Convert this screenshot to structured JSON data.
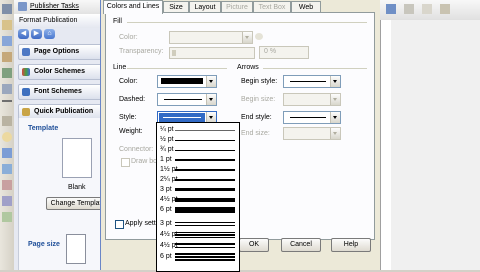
{
  "menu": {
    "partial_title": "Publisher Tasks"
  },
  "task_pane": {
    "title": "Format Publication",
    "sections": [
      {
        "label": "Page Options"
      },
      {
        "label": "Color Schemes"
      },
      {
        "label": "Font Schemes"
      },
      {
        "label": "Quick Publication"
      }
    ],
    "template_label": "Template",
    "template_name": "Blank",
    "change_template_button": "Change Template",
    "page_size_label": "Page size"
  },
  "dialog": {
    "tabs": [
      {
        "label": "Colors and Lines",
        "active": true
      },
      {
        "label": "Size"
      },
      {
        "label": "Layout"
      },
      {
        "label": "Picture",
        "disabled": true
      },
      {
        "label": "Text Box",
        "disabled": true
      },
      {
        "label": "Web"
      }
    ],
    "fill": {
      "group_label": "Fill",
      "color_label": "Color:",
      "transparency_label": "Transparency:",
      "transparency_value": "0 %"
    },
    "line": {
      "group_label": "Line",
      "color_label": "Color:",
      "dashed_label": "Dashed:",
      "style_label": "Style:",
      "weight_label": "Weight:",
      "connector_label": "Connector:",
      "draw_border_label": "Draw bor"
    },
    "arrows": {
      "group_label": "Arrows",
      "begin_style_label": "Begin style:",
      "begin_size_label": "Begin size:",
      "end_style_label": "End style:",
      "end_size_label": "End size:"
    },
    "apply_settings_label": "Apply setti",
    "buttons": {
      "ok": "OK",
      "cancel": "Cancel",
      "help": "Help"
    }
  },
  "line_style_dropdown": {
    "items": [
      {
        "label": "¼ pt"
      },
      {
        "label": "½ pt"
      },
      {
        "label": "¾ pt"
      },
      {
        "label": "1 pt"
      },
      {
        "label": "1½ pt"
      },
      {
        "label": "2¼ pt"
      },
      {
        "label": "3 pt"
      },
      {
        "label": "4½ pt"
      },
      {
        "label": "6 pt"
      },
      {
        "label": "3 pt"
      },
      {
        "label": "4½ pt"
      },
      {
        "label": "4½ pt"
      },
      {
        "label": "6 pt"
      }
    ]
  },
  "colors": {
    "selection": "#316ac5",
    "task_pane_bg": "#e6e9f2",
    "dialog_bg": "#ece9d8"
  }
}
